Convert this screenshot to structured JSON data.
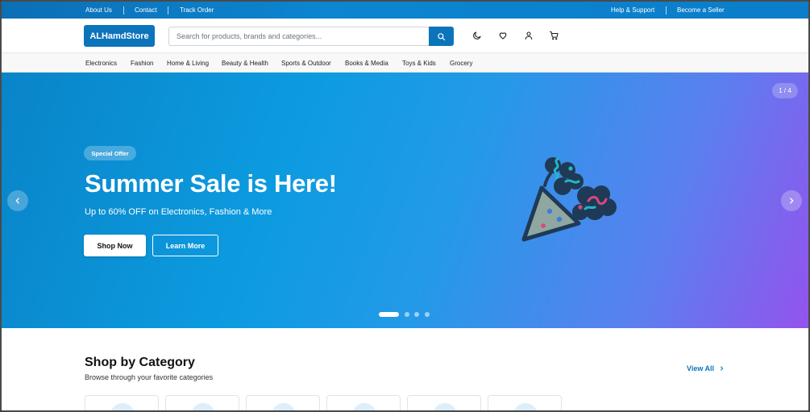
{
  "topbar": {
    "left_links": [
      "About Us",
      "Contact",
      "Track Order"
    ],
    "right_links": [
      "Help & Support",
      "Become a Seller"
    ]
  },
  "header": {
    "logo": "ALHamdStore",
    "search_placeholder": "Search for products, brands and categories...",
    "icons": [
      "moon-icon",
      "heart-icon",
      "user-icon",
      "cart-icon"
    ]
  },
  "categories_nav": [
    "Electronics",
    "Fashion",
    "Home & Living",
    "Beauty & Health",
    "Sports & Outdoor",
    "Books & Media",
    "Toys & Kids",
    "Grocery"
  ],
  "hero": {
    "slide_counter": "1 / 4",
    "badge": "Special Offer",
    "headline": "Summer Sale is Here!",
    "subtitle": "Up to 60% OFF on Electronics, Fashion & More",
    "primary_button": "Shop Now",
    "secondary_button": "Learn More",
    "active_slide": 1,
    "slide_count": 4,
    "gradient_start": "#0a84c8",
    "gradient_end": "#9353ee"
  },
  "category_section": {
    "title": "Shop by Category",
    "subtitle": "Browse through your favorite categories",
    "view_all": "View All"
  },
  "colors": {
    "brand": "#0b74bb",
    "topbar": "#0d85d0"
  }
}
